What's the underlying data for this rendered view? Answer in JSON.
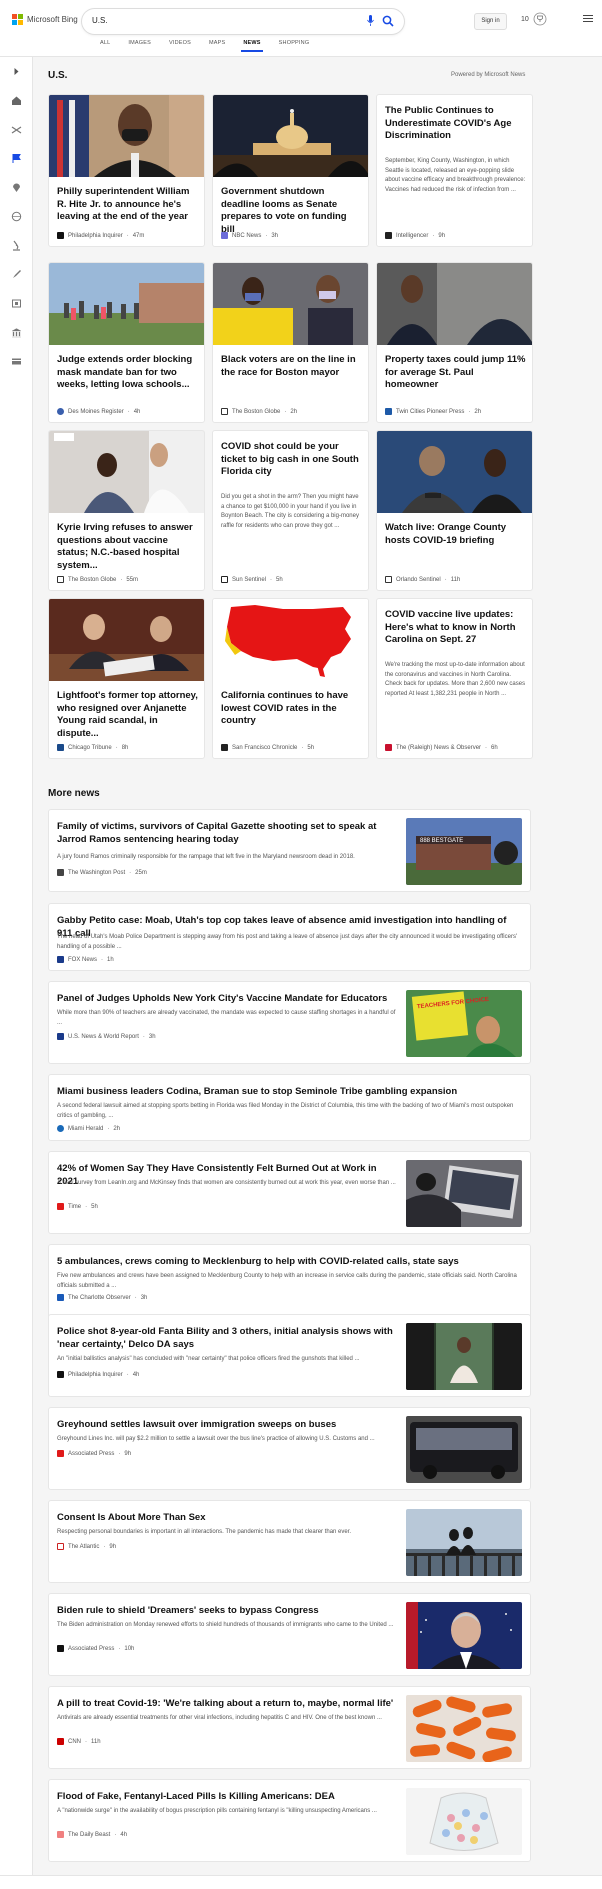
{
  "header": {
    "brand": "Microsoft Bing",
    "search_value": "U.S.",
    "signin": "Sign in",
    "rewards_count": "10",
    "tabs": [
      {
        "label": "ALL"
      },
      {
        "label": "IMAGES"
      },
      {
        "label": "VIDEOS"
      },
      {
        "label": "MAPS"
      },
      {
        "label": "NEWS"
      },
      {
        "label": "SHOPPING"
      }
    ],
    "active_tab": "NEWS",
    "logo_colors": [
      "#f25022",
      "#7fba00",
      "#00a4ef",
      "#ffb900"
    ],
    "accent": "#174ae4"
  },
  "sidebar": {
    "icons": [
      "expand-icon",
      "home-icon",
      "shuffle-icon",
      "flag-icon",
      "location-icon",
      "globe-icon",
      "microscope-icon",
      "rocket-icon",
      "film-icon",
      "bank-icon",
      "card-icon"
    ]
  },
  "section": {
    "title": "U.S.",
    "powered_by": "Powered by Microsoft News"
  },
  "cards": [
    {
      "title": "Philly superintendent William R. Hite Jr. to announce he's leaving at the end of the year",
      "source": "Philadelphia Inquirer",
      "time": "47m"
    },
    {
      "title": "Government shutdown deadline looms as Senate prepares to vote on funding bill",
      "source": "NBC News",
      "time": "3h"
    },
    {
      "title": "The Public Continues to Underestimate COVID's Age Discrimination",
      "snippet": "September, King County, Washington, in which Seattle is located, released an eye-popping slide about vaccine efficacy and breakthrough prevalence: Vaccines had reduced the risk of infection from ...",
      "source": "Intelligencer",
      "time": "9h"
    },
    {
      "title": "Judge extends order blocking mask mandate ban for two weeks, letting Iowa schools...",
      "source": "Des Moines Register",
      "time": "4h"
    },
    {
      "title": "Black voters are on the line in the race for Boston mayor",
      "source": "The Boston Globe",
      "time": "2h"
    },
    {
      "title": "Property taxes could jump 11% for average St. Paul homeowner",
      "source": "Twin Cities Pioneer Press",
      "time": "2h"
    },
    {
      "title": "Kyrie Irving refuses to answer questions about vaccine status; N.C.-based hospital system...",
      "source": "The Boston Globe",
      "time": "55m"
    },
    {
      "title": "COVID shot could be your ticket to big cash in one South Florida city",
      "snippet": "Did you get a shot in the arm? Then you might have a chance to get $100,000 in your hand if you live in Boynton Beach. The city is considering a big-money raffle for residents who can prove they got ...",
      "source": "Sun Sentinel",
      "time": "5h"
    },
    {
      "title": "Watch live: Orange County hosts COVID-19 briefing",
      "source": "Orlando Sentinel",
      "time": "11h"
    },
    {
      "title": "Lightfoot's former top attorney, who resigned over Anjanette Young raid scandal, in dispute...",
      "source": "Chicago Tribune",
      "time": "8h"
    },
    {
      "title": "California continues to have lowest COVID rates in the country",
      "source": "San Francisco Chronicle",
      "time": "5h"
    },
    {
      "title": "COVID vaccine live updates: Here's what to know in North Carolina on Sept. 27",
      "snippet": "We're tracking the most up-to-date information about the coronavirus and vaccines in North Carolina. Check back for updates. More than 2,600 new cases reported At least 1,382,231 people in North ...",
      "source": "The (Raleigh) News & Observer",
      "time": "6h"
    }
  ],
  "more_news": {
    "title": "More news",
    "items": [
      {
        "title": "Family of victims, survivors of Capital Gazette shooting set to speak at Jarrod Ramos sentencing hearing today",
        "snippet": "A jury found Ramos criminally responsible for the rampage that left five in the Maryland newsroom dead in 2018.",
        "source": "The Washington Post",
        "time": "25m",
        "thumb_text": "888 BESTGATE"
      },
      {
        "title": "Gabby Petito case: Moab, Utah's top cop takes leave of absence amid investigation into handling of 911 call",
        "snippet": "The head of Utah's Moab Police Department is stepping away from his post and taking a leave of absence just days after the city announced it would be investigating officers' handling of a possible ...",
        "source": "FOX News",
        "time": "1h"
      },
      {
        "title": "Panel of Judges Upholds New York City's Vaccine Mandate for Educators",
        "snippet": "While more than 90% of teachers are already vaccinated, the mandate was expected to cause staffing shortages in a handful of ...",
        "source": "U.S. News & World Report",
        "time": "3h",
        "thumb_text": "TEACHERS FOR CHOICE"
      },
      {
        "title": "Miami business leaders Codina, Braman sue to stop Seminole Tribe gambling expansion",
        "snippet": "A second federal lawsuit aimed at stopping sports betting in Florida was filed Monday in the District of Columbia, this time with the backing of two of Miami's most outspoken critics of gambling, ...",
        "source": "Miami Herald",
        "time": "2h"
      },
      {
        "title": "42% of Women Say They Have Consistently Felt Burned Out at Work in 2021",
        "snippet": "A new survey from LeanIn.org and McKinsey finds that women are consistently burned out at work this year, even worse than ...",
        "source": "Time",
        "time": "5h"
      },
      {
        "title": "5 ambulances, crews coming to Mecklenburg to help with COVID-related calls, state says",
        "snippet": "Five new ambulances and crews have been assigned to Mecklenburg County to help with an increase in service calls during the pandemic, state officials said. North Carolina officials submitted a ...",
        "source": "The Charlotte Observer",
        "time": "3h"
      },
      {
        "title": "Police shot 8-year-old Fanta Bility and 3 others, initial analysis shows with 'near certainty,' Delco DA says",
        "snippet": "An \"initial ballistics analysis\" has concluded with \"near certainty\" that police officers fired the gunshots that killed ...",
        "source": "Philadelphia Inquirer",
        "time": "4h"
      },
      {
        "title": "Greyhound settles lawsuit over immigration sweeps on buses",
        "snippet": "Greyhound Lines Inc. will pay $2.2 million to settle a lawsuit over the bus line's practice of allowing U.S. Customs and ...",
        "source": "Associated Press",
        "time": "9h"
      },
      {
        "title": "Consent Is About More Than Sex",
        "snippet": "Respecting personal boundaries is important in all interactions. The pandemic has made that clearer than ever.",
        "source": "The Atlantic",
        "time": "9h"
      },
      {
        "title": "Biden rule to shield 'Dreamers' seeks to bypass Congress",
        "snippet": "The Biden administration on Monday renewed efforts to shield hundreds of thousands of immigrants who came to the United ...",
        "source": "Associated Press",
        "time": "10h"
      },
      {
        "title": "A pill to treat Covid-19: 'We're talking about a return to, maybe, normal life'",
        "snippet": "Antivirals are already essential treatments for other viral infections, including hepatitis C and HIV. One of the best known ...",
        "source": "CNN",
        "time": "11h"
      },
      {
        "title": "Flood of Fake, Fentanyl-Laced Pills Is Killing Americans: DEA",
        "snippet": "A \"nationwide surge\" in the availability of bogus prescription pills containing fentanyl is \"killing unsuspecting Americans ...",
        "source": "The Daily Beast",
        "time": "4h"
      }
    ]
  }
}
